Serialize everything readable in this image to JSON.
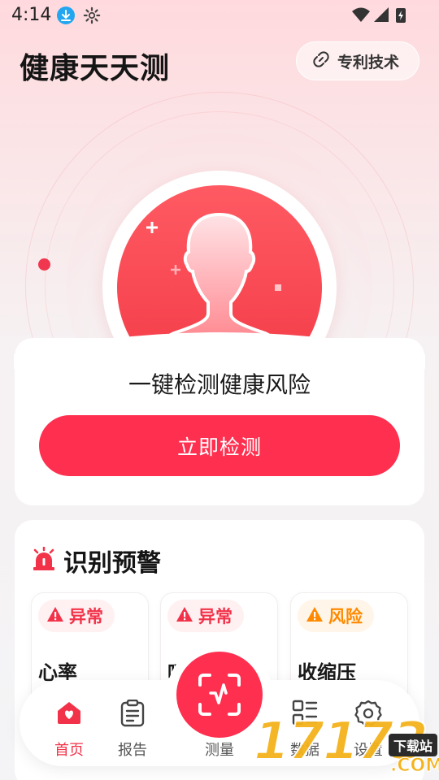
{
  "status_bar": {
    "time": "4:14"
  },
  "header": {
    "title": "健康天天测",
    "patent_label": "专利技术"
  },
  "detect": {
    "title": "一键检测健康风险",
    "button_label": "立即检测"
  },
  "warnings": {
    "title": "识别预警",
    "items": [
      {
        "badge": "异常",
        "level": "abnormal",
        "name": "心率"
      },
      {
        "badge": "异常",
        "level": "abnormal",
        "name": "呼"
      },
      {
        "badge": "风险",
        "level": "risk",
        "name": "收缩压"
      }
    ]
  },
  "nav": {
    "items": [
      {
        "label": "首页",
        "icon": "home-heart-icon",
        "active": true
      },
      {
        "label": "报告",
        "icon": "clipboard-icon",
        "active": false
      },
      {
        "label": "测量",
        "icon": "face-scan-icon",
        "active": false
      },
      {
        "label": "数据",
        "icon": "list-grid-icon",
        "active": false
      },
      {
        "label": "设置",
        "icon": "gear-icon",
        "active": false
      }
    ]
  },
  "watermark": {
    "number": "17173",
    "tag": "下载站",
    "domain": ".COM"
  },
  "colors": {
    "accent": "#ff2f4f",
    "abnormal": "#f23249",
    "risk": "#ff8a00"
  }
}
